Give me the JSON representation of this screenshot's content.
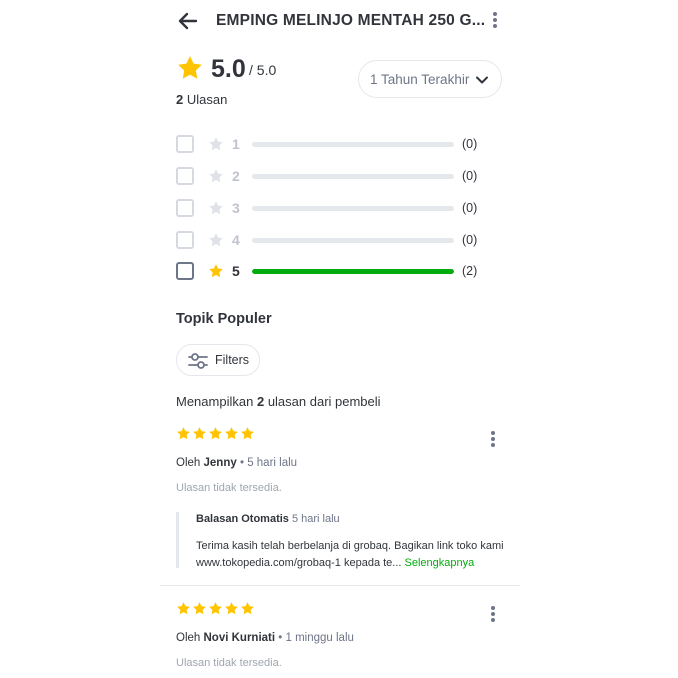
{
  "header": {
    "title": "EMPING MELINJO MENTAH 250 G...",
    "back_icon": "arrow-left-icon",
    "menu_icon": "kebab-menu-icon"
  },
  "summary": {
    "rating": "5.0",
    "rating_max": "/ 5.0",
    "review_count": "2",
    "review_label": "Ulasan",
    "star_color": "#ffc400"
  },
  "period_filter": {
    "selected": "1 Tahun Terakhir"
  },
  "breakdown": [
    {
      "star": "1",
      "count_label": "(0)",
      "fraction": 0,
      "checked": false
    },
    {
      "star": "2",
      "count_label": "(0)",
      "fraction": 0,
      "checked": false
    },
    {
      "star": "3",
      "count_label": "(0)",
      "fraction": 0,
      "checked": false
    },
    {
      "star": "4",
      "count_label": "(0)",
      "fraction": 0,
      "checked": false
    },
    {
      "star": "5",
      "count_label": "(2)",
      "fraction": 1,
      "checked": false
    }
  ],
  "topics": {
    "heading": "Topik Populer",
    "filters_label": "Filters"
  },
  "showing": {
    "prefix": "Menampilkan",
    "count": "2",
    "suffix": "ulasan dari pembeli"
  },
  "reviews": [
    {
      "stars": 5,
      "by_prefix": "Oleh",
      "name": "Jenny",
      "separator": "•",
      "time": "5 hari lalu",
      "text": "Ulasan tidak tersedia.",
      "reply": {
        "title": "Balasan Otomatis",
        "time": "5 hari lalu",
        "text": "Terima kasih telah berbelanja di grobaq. Bagikan link toko kami www.tokopedia.com/grobaq-1 kepada te...",
        "more": "Selengkapnya"
      }
    },
    {
      "stars": 5,
      "by_prefix": "Oleh",
      "name": "Novi Kurniati",
      "separator": "•",
      "time": "1 minggu lalu",
      "text": "Ulasan tidak tersedia."
    }
  ],
  "colors": {
    "accent_green": "#03ac0e",
    "star_gold": "#ffc400",
    "text_dark": "#31353b",
    "text_muted": "#6d7588"
  }
}
